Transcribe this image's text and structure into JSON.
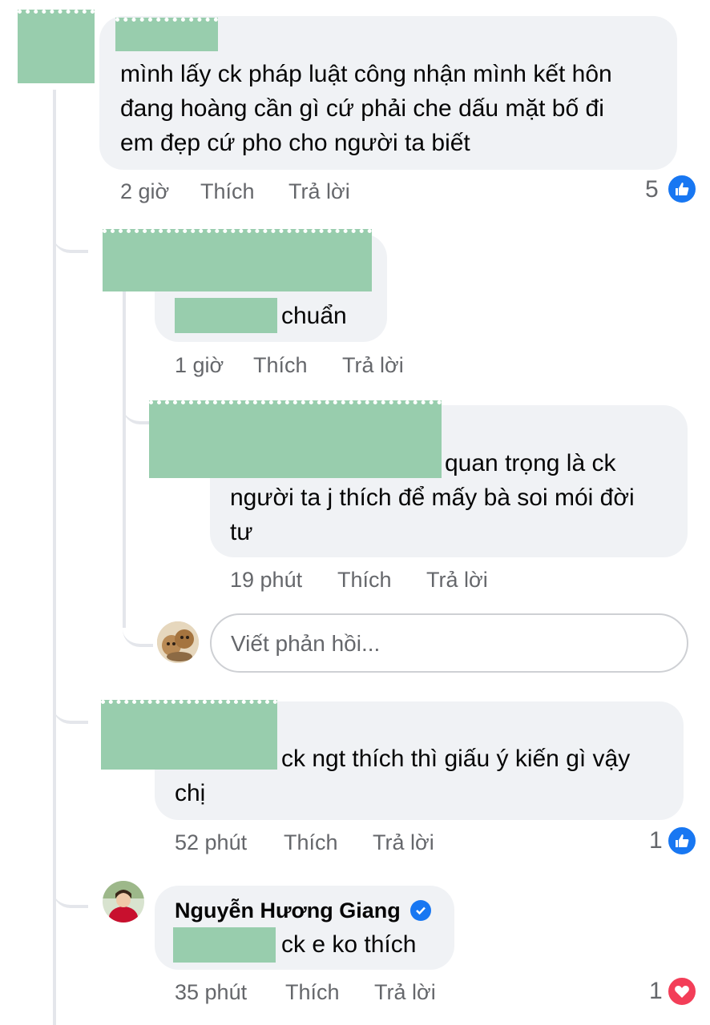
{
  "comments": [
    {
      "text": "mình lấy ck pháp luật công nhận mình kết hôn đang hoàng cần gì cứ phải che dấu mặt bố đi em đẹp cứ pho cho người ta biết",
      "lines": [
        "mình lấy ck pháp luật công nhận mình kết hôn",
        "đang hoàng cần gì cứ phải che dấu mặt bố đi",
        "em đẹp cứ pho cho người ta biết"
      ],
      "time": "2 giờ",
      "like_label": "Thích",
      "reply_label": "Trả lời",
      "reaction_count": "5",
      "reaction_type": "like-icon"
    },
    {
      "text": "chuẩn",
      "time": "1 giờ",
      "like_label": "Thích",
      "reply_label": "Trả lời"
    },
    {
      "lines": [
        "quan trọng là ck",
        "người ta j thích để mấy bà soi mói đời",
        "tư"
      ],
      "time": "19 phút",
      "like_label": "Thích",
      "reply_label": "Trả lời"
    },
    {
      "lines": [
        "ck ngt thích thì giấu ý kiến gì vậy",
        "chị"
      ],
      "time": "52 phút",
      "like_label": "Thích",
      "reply_label": "Trả lời",
      "reaction_count": "1",
      "reaction_type": "like-icon"
    },
    {
      "author": "Nguyễn Hương Giang",
      "text": "ck e ko thích",
      "time": "35 phút",
      "like_label": "Thích",
      "reply_label": "Trả lời",
      "reaction_count": "1",
      "reaction_type": "heart-icon"
    }
  ],
  "reply_box": {
    "placeholder": "Viết phản hồi..."
  },
  "colors": {
    "bubble": "#f0f2f5",
    "redaction": "#98cdad",
    "like_blue": "#1877f2",
    "heart_red": "#f33e58",
    "meta_gray": "#65676b"
  }
}
